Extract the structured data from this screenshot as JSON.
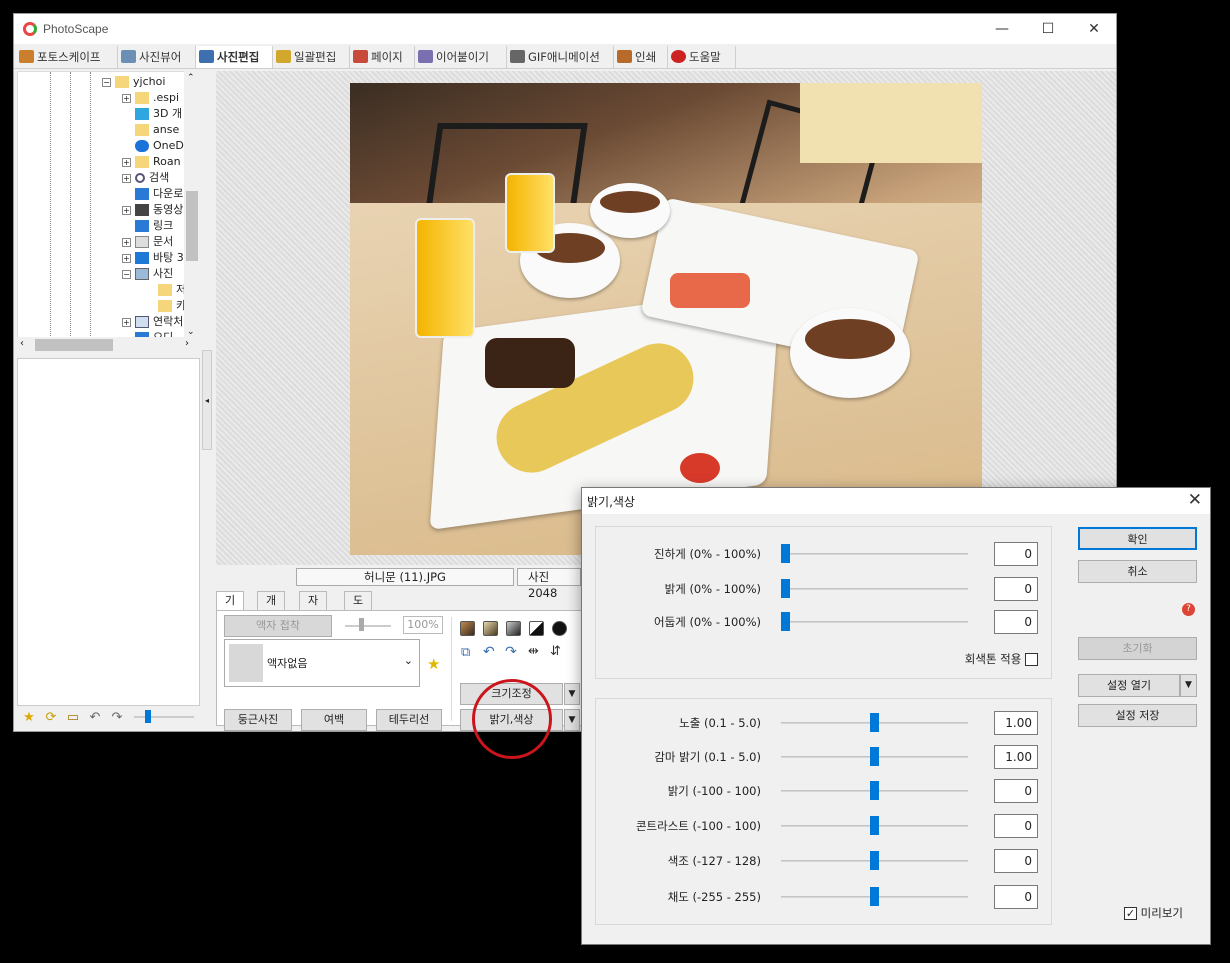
{
  "window": {
    "title": "PhotoScape",
    "min": "—",
    "max": "☐",
    "close": "✕"
  },
  "tabs": [
    {
      "label": "포토스케이프",
      "color": "#c97f2c"
    },
    {
      "label": "사진뷰어",
      "color": "#6c8fb5"
    },
    {
      "label": "사진편집",
      "color": "#3e6fae"
    },
    {
      "label": "일괄편집",
      "color": "#d2a72e"
    },
    {
      "label": "페이지",
      "color": "#c84a3a"
    },
    {
      "label": "이어붙이기",
      "color": "#7a6fb0"
    },
    {
      "label": "GIF애니메이션",
      "color": "#666666"
    },
    {
      "label": "인쇄",
      "color": "#b86a2a"
    },
    {
      "label": "도움말",
      "color": "#cc2222"
    }
  ],
  "tree": {
    "items": [
      {
        "label": "yjchoi",
        "icon": "folder-icon"
      },
      {
        "label": ".espi",
        "icon": "folder-icon"
      },
      {
        "label": "3D 개",
        "icon": "cube-icon"
      },
      {
        "label": "anse",
        "icon": "folder-icon"
      },
      {
        "label": "OneD",
        "icon": "cloud-icon"
      },
      {
        "label": "Roan",
        "icon": "folder-icon"
      },
      {
        "label": "검색",
        "icon": "search-icon"
      },
      {
        "label": "다운로",
        "icon": "download-icon"
      },
      {
        "label": "동영상",
        "icon": "video-icon"
      },
      {
        "label": "링크",
        "icon": "link-icon"
      },
      {
        "label": "문서",
        "icon": "document-icon"
      },
      {
        "label": "바탕 3",
        "icon": "desktop-icon"
      },
      {
        "label": "사진",
        "icon": "pictures-icon"
      },
      {
        "label": "저",
        "icon": "folder-icon"
      },
      {
        "label": "카",
        "icon": "folder-icon"
      },
      {
        "label": "연락처",
        "icon": "contacts-icon"
      },
      {
        "label": "오디",
        "icon": "audio-icon"
      }
    ]
  },
  "info": {
    "filename": "허니문 (11).JPG",
    "size_prefix": "사진 2048"
  },
  "bottom_tabs": [
    "기본",
    "개체",
    "자르기",
    "도구"
  ],
  "bottom_panel": {
    "frame_attach": "액자 접착",
    "zoom_value": "100%",
    "frame_select": "액자없음",
    "round_photo": "둥근사진",
    "margin": "여백",
    "border_line": "테두리선",
    "resize": "크기조정",
    "brightness_color": "밝기,색상"
  },
  "dialog": {
    "title": "밝기,색상",
    "top_sliders": [
      {
        "label": "진하게 (0% - 100%)",
        "value": "0",
        "level": 0
      },
      {
        "label": "밝게 (0% - 100%)",
        "value": "0",
        "level": 0
      },
      {
        "label": "어둡게 (0% - 100%)",
        "value": "0",
        "level": 0
      }
    ],
    "grayscale_label": "회색톤 적용",
    "bottom_sliders": [
      {
        "label": "노출 (0.1 - 5.0)",
        "value": "1.00",
        "level": 0.5
      },
      {
        "label": "감마 밝기 (0.1 - 5.0)",
        "value": "1.00",
        "level": 0.5
      },
      {
        "label": "밝기 (-100 - 100)",
        "value": "0",
        "level": 0.5
      },
      {
        "label": "콘트라스트 (-100 - 100)",
        "value": "0",
        "level": 0.5
      },
      {
        "label": "색조 (-127 - 128)",
        "value": "0",
        "level": 0.5
      },
      {
        "label": "채도 (-255 - 255)",
        "value": "0",
        "level": 0.5
      }
    ],
    "ok": "확인",
    "cancel": "취소",
    "reset": "초기화",
    "open_settings": "설정 열기",
    "save_settings": "설정 저장",
    "preview_label": "미리보기",
    "preview_checked": true
  }
}
